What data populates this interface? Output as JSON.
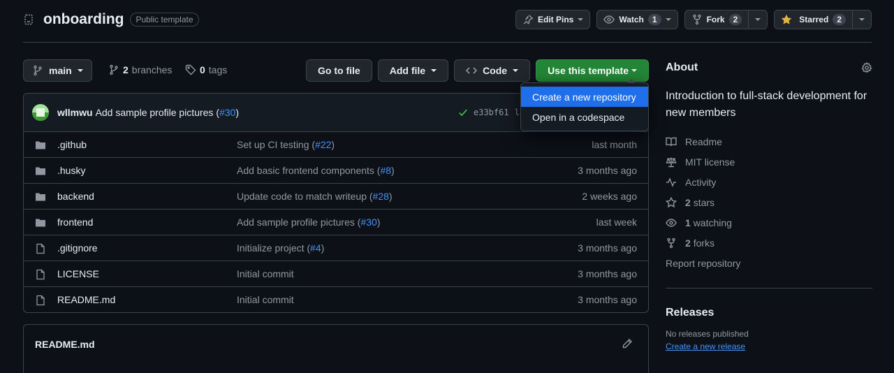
{
  "repo": {
    "name": "onboarding",
    "badge": "Public template"
  },
  "header_actions": {
    "edit_pins": "Edit Pins",
    "watch": "Watch",
    "watch_count": "1",
    "fork": "Fork",
    "fork_count": "2",
    "starred": "Starred",
    "star_count": "2"
  },
  "toolbar": {
    "branch": "main",
    "branches_count": "2",
    "branches_label": "branches",
    "tags_count": "0",
    "tags_label": "tags",
    "go_to_file": "Go to file",
    "add_file": "Add file",
    "code": "Code",
    "use_template": "Use this template"
  },
  "template_menu": {
    "items": [
      "Create a new repository",
      "Open in a codespace"
    ]
  },
  "latest_commit": {
    "author": "wllmwu",
    "message": "Add sample profile pictures (",
    "pr": "#30",
    "close": ")",
    "sha": "e33bf61",
    "time_fragment": "la"
  },
  "files": [
    {
      "type": "dir",
      "name": ".github",
      "msg": "Set up CI testing (",
      "pr": "#22",
      "close": ")",
      "time": "last month"
    },
    {
      "type": "dir",
      "name": ".husky",
      "msg": "Add basic frontend components (",
      "pr": "#8",
      "close": ")",
      "time": "3 months ago"
    },
    {
      "type": "dir",
      "name": "backend",
      "msg": "Update code to match writeup (",
      "pr": "#28",
      "close": ")",
      "time": "2 weeks ago"
    },
    {
      "type": "dir",
      "name": "frontend",
      "msg": "Add sample profile pictures (",
      "pr": "#30",
      "close": ")",
      "time": "last week"
    },
    {
      "type": "file",
      "name": ".gitignore",
      "msg": "Initialize project (",
      "pr": "#4",
      "close": ")",
      "time": "3 months ago"
    },
    {
      "type": "file",
      "name": "LICENSE",
      "msg": "Initial commit",
      "pr": "",
      "close": "",
      "time": "3 months ago"
    },
    {
      "type": "file",
      "name": "README.md",
      "msg": "Initial commit",
      "pr": "",
      "close": "",
      "time": "3 months ago"
    }
  ],
  "readme": {
    "title": "README.md"
  },
  "about": {
    "heading": "About",
    "description": "Introduction to full-stack development for new members",
    "items": [
      {
        "icon": "book-icon",
        "strong": "",
        "label": "Readme"
      },
      {
        "icon": "law-icon",
        "strong": "",
        "label": "MIT license"
      },
      {
        "icon": "pulse-icon",
        "strong": "",
        "label": "Activity"
      },
      {
        "icon": "star-icon",
        "strong": "2",
        "label": "stars"
      },
      {
        "icon": "eye-icon",
        "strong": "1",
        "label": "watching"
      },
      {
        "icon": "fork-icon",
        "strong": "2",
        "label": "forks"
      }
    ],
    "report": "Report repository"
  },
  "releases": {
    "heading": "Releases",
    "none": "No releases published",
    "create": "Create a new release"
  },
  "colors": {
    "background": "#0d1117",
    "border": "#3d444d",
    "accent_green": "#238636",
    "link_blue": "#4493f8",
    "menu_highlight": "#1f6feb",
    "star_yellow": "#e3b341"
  }
}
